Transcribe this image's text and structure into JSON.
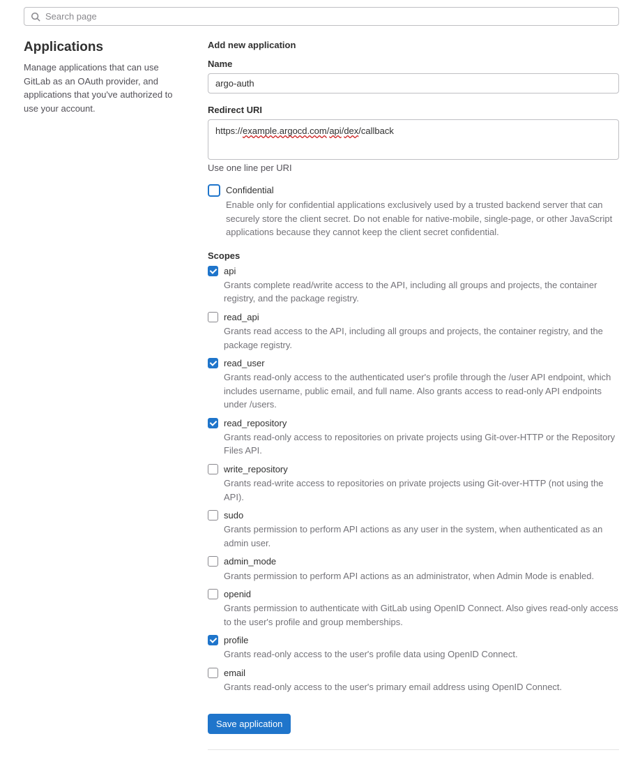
{
  "search": {
    "placeholder": "Search page"
  },
  "sidebar": {
    "title": "Applications",
    "desc": "Manage applications that can use GitLab as an OAuth provider, and applications that you've authorized to use your account."
  },
  "form": {
    "heading": "Add new application",
    "name": {
      "label": "Name",
      "value": "argo-auth"
    },
    "redirect": {
      "label": "Redirect URI",
      "value_parts": {
        "p0": "https://",
        "p1": "example.argocd.com",
        "p2": "/",
        "p3": "api",
        "p4": "/",
        "p5": "dex",
        "p6": "/callback"
      },
      "help": "Use one line per URI"
    },
    "confidential": {
      "label": "Confidential",
      "desc": "Enable only for confidential applications exclusively used by a trusted backend server that can securely store the client secret. Do not enable for native-mobile, single-page, or other JavaScript applications because they cannot keep the client secret confidential.",
      "checked": false
    },
    "scopes": {
      "label": "Scopes",
      "items": [
        {
          "name": "api",
          "checked": true,
          "desc": "Grants complete read/write access to the API, including all groups and projects, the container registry, and the package registry."
        },
        {
          "name": "read_api",
          "checked": false,
          "desc": "Grants read access to the API, including all groups and projects, the container registry, and the package registry."
        },
        {
          "name": "read_user",
          "checked": true,
          "desc": "Grants read-only access to the authenticated user's profile through the /user API endpoint, which includes username, public email, and full name. Also grants access to read-only API endpoints under /users."
        },
        {
          "name": "read_repository",
          "checked": true,
          "desc": "Grants read-only access to repositories on private projects using Git-over-HTTP or the Repository Files API."
        },
        {
          "name": "write_repository",
          "checked": false,
          "desc": "Grants read-write access to repositories on private projects using Git-over-HTTP (not using the API)."
        },
        {
          "name": "sudo",
          "checked": false,
          "desc": "Grants permission to perform API actions as any user in the system, when authenticated as an admin user."
        },
        {
          "name": "admin_mode",
          "checked": false,
          "desc": "Grants permission to perform API actions as an administrator, when Admin Mode is enabled."
        },
        {
          "name": "openid",
          "checked": false,
          "desc": "Grants permission to authenticate with GitLab using OpenID Connect. Also gives read-only access to the user's profile and group memberships."
        },
        {
          "name": "profile",
          "checked": true,
          "desc": "Grants read-only access to the user's profile data using OpenID Connect."
        },
        {
          "name": "email",
          "checked": false,
          "desc": "Grants read-only access to the user's primary email address using OpenID Connect."
        }
      ]
    },
    "save_label": "Save application"
  }
}
